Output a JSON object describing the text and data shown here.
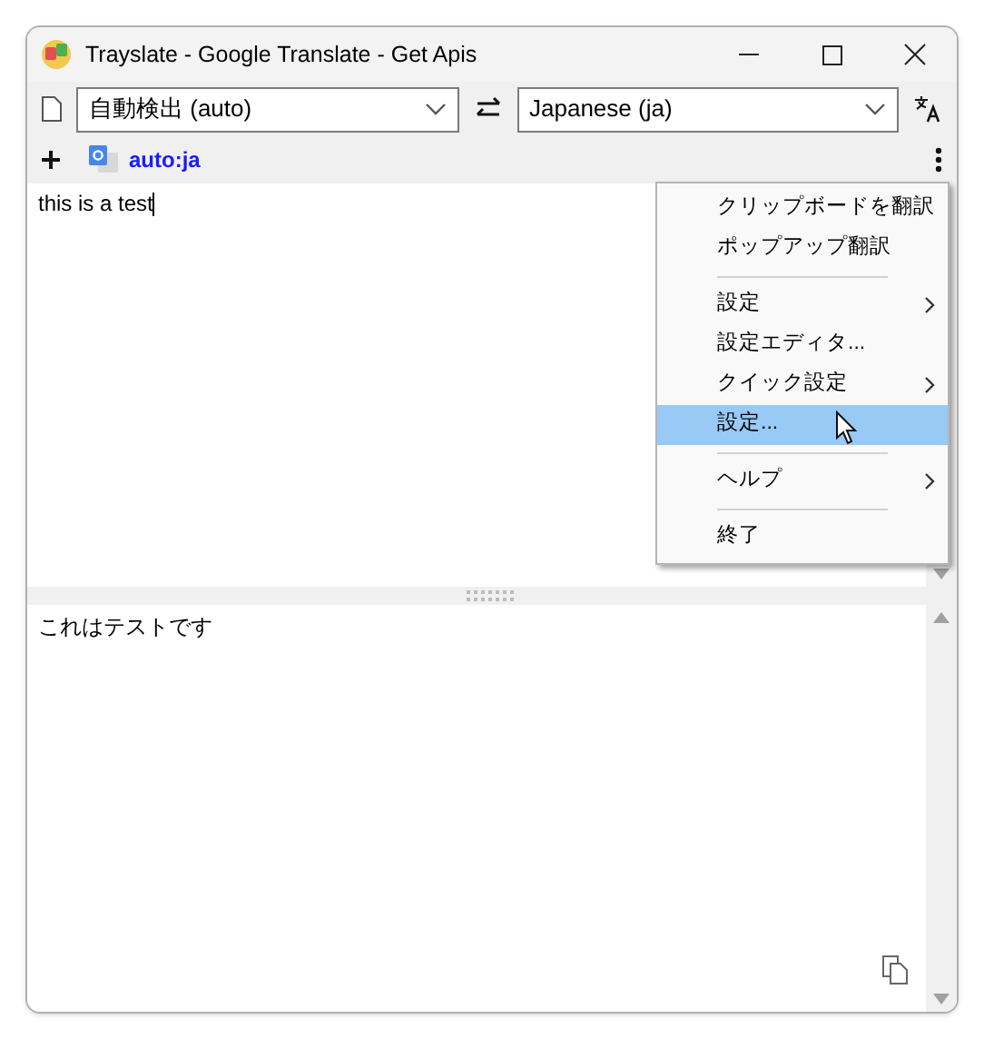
{
  "window": {
    "title": "Trayslate - Google Translate - Get Apis"
  },
  "toolbar": {
    "source_language": "自動検出 (auto)",
    "target_language": "Japanese (ja)"
  },
  "tabs": [
    {
      "label": "auto:ja",
      "selected": true
    }
  ],
  "source_text": "this is a test",
  "translation_text": "これはテストです",
  "menu": [
    {
      "kind": "item",
      "label": "クリップボードを翻訳",
      "submenu": false,
      "selected": false
    },
    {
      "kind": "item",
      "label": "ポップアップ翻訳",
      "submenu": false,
      "selected": false
    },
    {
      "kind": "separator"
    },
    {
      "kind": "item",
      "label": "設定",
      "submenu": true,
      "selected": false
    },
    {
      "kind": "item",
      "label": "設定エディタ...",
      "submenu": false,
      "selected": false
    },
    {
      "kind": "item",
      "label": "クイック設定",
      "submenu": true,
      "selected": false
    },
    {
      "kind": "item",
      "label": "設定...",
      "submenu": false,
      "selected": true
    },
    {
      "kind": "separator"
    },
    {
      "kind": "item",
      "label": "ヘルプ",
      "submenu": true,
      "selected": false
    },
    {
      "kind": "separator"
    },
    {
      "kind": "item",
      "label": "終了",
      "submenu": false,
      "selected": false
    }
  ]
}
